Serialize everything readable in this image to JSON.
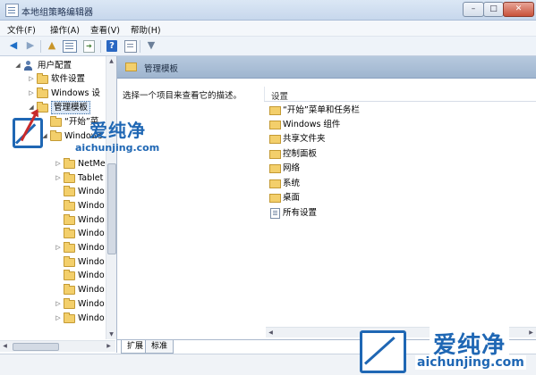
{
  "window": {
    "title": "本地组策略编辑器",
    "buttons": {
      "minimize": "–",
      "maximize": "□",
      "close": "✕"
    }
  },
  "menu": {
    "items": [
      "文件(F)",
      "操作(A)",
      "查看(V)",
      "帮助(H)"
    ]
  },
  "toolbar": {
    "icons": [
      "back-arrow-icon",
      "forward-arrow-icon",
      "up-folder-icon",
      "show-tree-icon",
      "export-list-icon",
      "help-icon",
      "properties-icon",
      "filter-icon"
    ]
  },
  "tree": {
    "user_config": "用户配置",
    "software_settings": "软件设置",
    "windows_settings": "Windows 设",
    "admin_templates": "管理模板",
    "start_menu": "“开始”菜",
    "windows_components": "Windows",
    "children": [
      "NetMe",
      "Tablet",
      "Windo",
      "Windo",
      "Windo",
      "Windo",
      "Windo",
      "Windo",
      "Windo",
      "Windo",
      "Windo",
      "Windo"
    ]
  },
  "right": {
    "header": "管理模板",
    "description": "选择一个项目来查看它的描述。",
    "column": "设置",
    "items": [
      "“开始”菜单和任务栏",
      "Windows 组件",
      "共享文件夹",
      "控制面板",
      "网络",
      "系统",
      "桌面"
    ],
    "all_settings": "所有设置"
  },
  "tabs": [
    "扩展",
    "标准"
  ],
  "watermark": {
    "brand": "爱纯净",
    "url1": "aichunjing.com",
    "url2": "aichunjing.com"
  },
  "colors": {
    "accent": "#1f67b4",
    "header": "#a9bed6",
    "folder": "#f3cf6b",
    "arrow": "#c82b2b"
  }
}
